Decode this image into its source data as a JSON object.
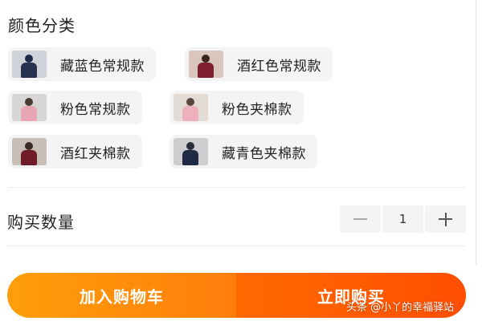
{
  "color_section": {
    "title": "颜色分类",
    "options": [
      {
        "label": "藏蓝色常规款",
        "thumb_colors": {
          "bg": "#cfd2d8",
          "head": "#1e2a4a",
          "body": "#26324f"
        }
      },
      {
        "label": "酒红色常规款",
        "thumb_colors": {
          "bg": "#d9c6bd",
          "head": "#3a2520",
          "body": "#7d1f2c"
        }
      },
      {
        "label": "粉色常规款",
        "thumb_colors": {
          "bg": "#d8d6d4",
          "head": "#4a3a33",
          "body": "#e8a6b4"
        }
      },
      {
        "label": "粉色夹棉款",
        "thumb_colors": {
          "bg": "#e3dcd6",
          "head": "#5a463c",
          "body": "#efb0bd"
        }
      },
      {
        "label": "酒红夹棉款",
        "thumb_colors": {
          "bg": "#c8bfb6",
          "head": "#3b2a24",
          "body": "#6e1d28"
        }
      },
      {
        "label": "藏青色夹棉款",
        "thumb_colors": {
          "bg": "#cfcdd0",
          "head": "#2a2d3c",
          "body": "#1f2a44"
        }
      }
    ]
  },
  "quantity": {
    "label": "购买数量",
    "value": "1",
    "minus_icon": "minus-icon",
    "plus_icon": "plus-icon"
  },
  "actions": {
    "add_to_cart": "加入购物车",
    "buy_now": "立即购买"
  },
  "watermark": "头条 @小丫的幸福驿站",
  "colors": {
    "chip_bg": "#f4f4f5",
    "cart_button": "#ff9e0b",
    "buy_button": "#ff5a00"
  }
}
